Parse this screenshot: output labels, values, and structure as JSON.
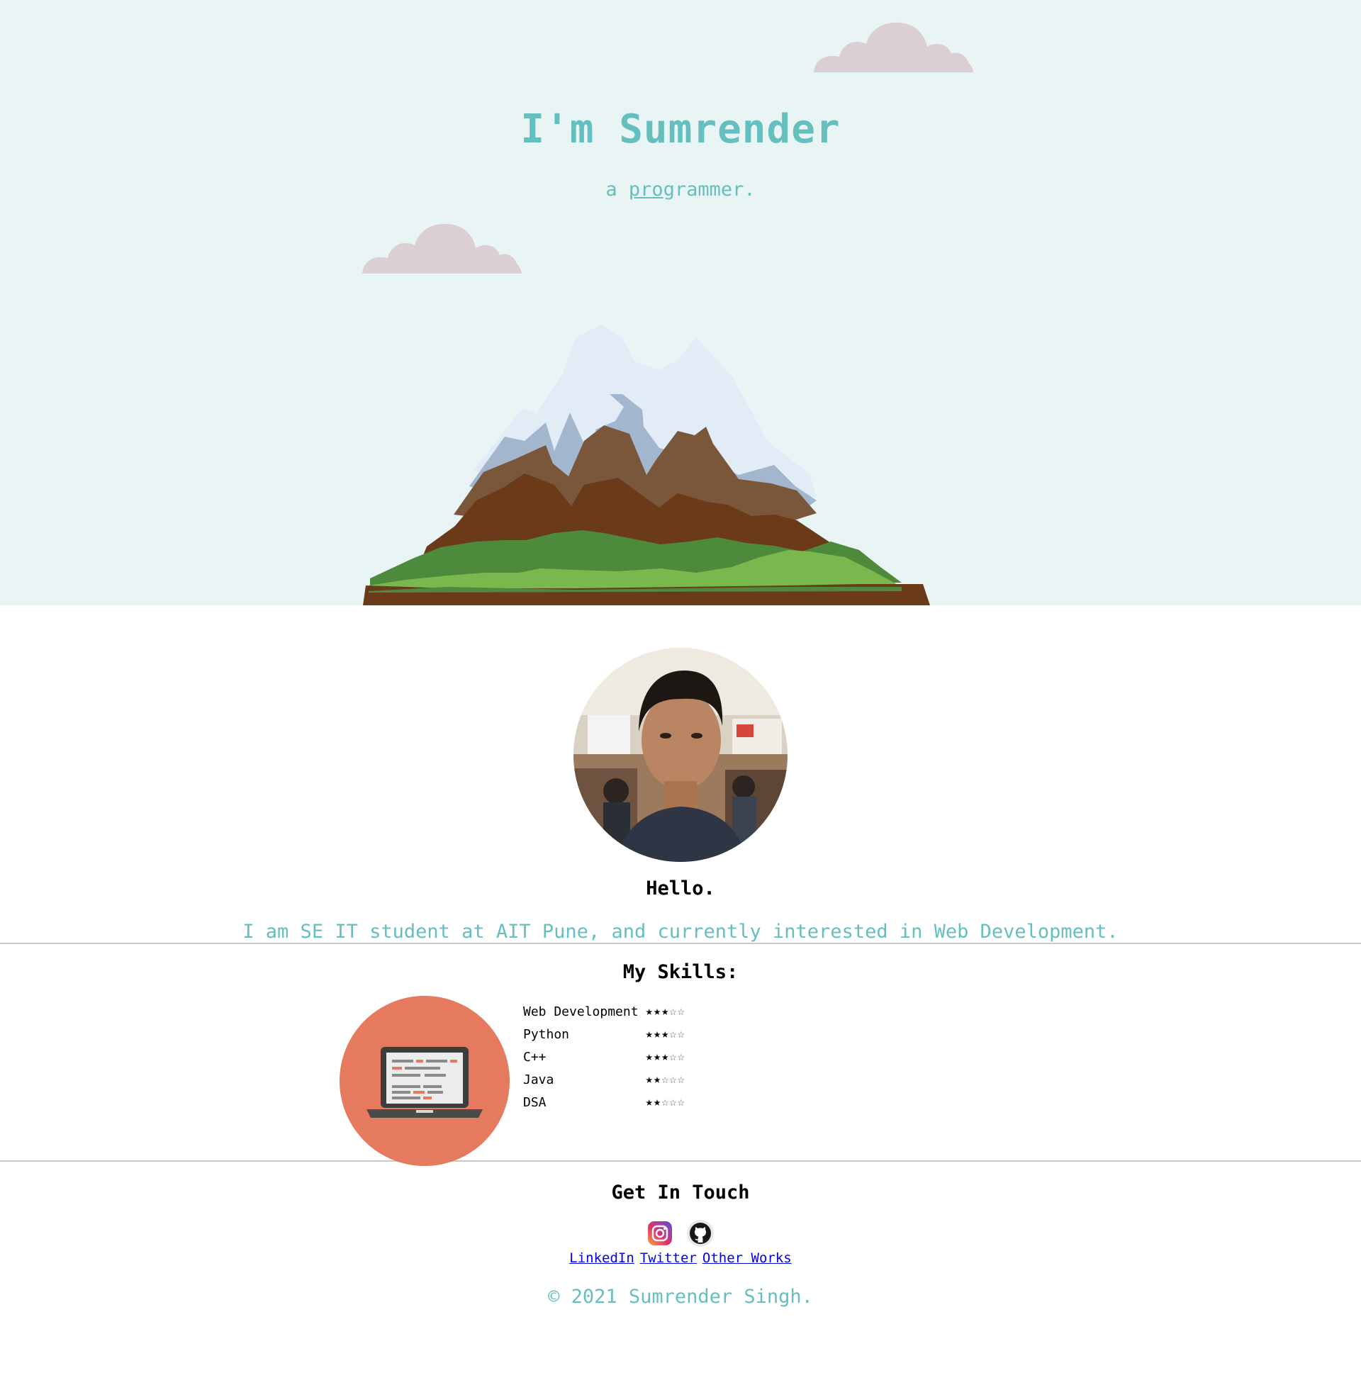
{
  "hero": {
    "title": "I'm Sumrender",
    "subtitle_prefix": "a",
    "subtitle_link": "pro",
    "subtitle_rest": "grammer."
  },
  "about": {
    "greeting": "Hello.",
    "bio": "I am SE IT student at AIT Pune, and currently interested in Web Development."
  },
  "skills": {
    "title": "My Skills:",
    "items": [
      {
        "name": "Web Development",
        "rating": 3,
        "max": 5
      },
      {
        "name": "Python",
        "rating": 3,
        "max": 5
      },
      {
        "name": "C++",
        "rating": 3,
        "max": 5
      },
      {
        "name": "Java",
        "rating": 2,
        "max": 5
      },
      {
        "name": "DSA",
        "rating": 2,
        "max": 5
      }
    ]
  },
  "contact": {
    "title": "Get In Touch",
    "icons": [
      "instagram-icon",
      "github-icon"
    ],
    "links": [
      "LinkedIn",
      "Twitter",
      "Other Works"
    ]
  },
  "footer": {
    "copyright": "© 2021 Sumrender Singh."
  },
  "colors": {
    "accent": "#66bfbf",
    "hero_bg": "#e9f5f5",
    "cloud": "#dbcfd3",
    "skills_circle": "#e67a5e",
    "link": "#0000ee"
  }
}
